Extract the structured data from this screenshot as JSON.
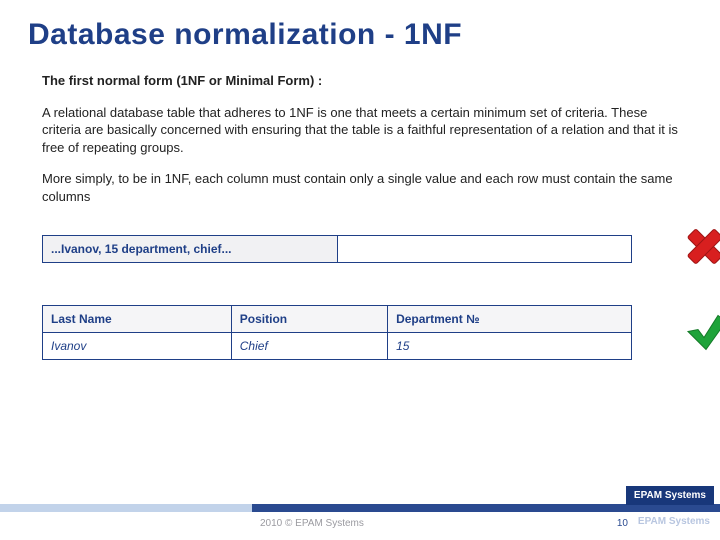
{
  "title": "Database normalization - 1NF",
  "intro_bold": "The first normal form (1NF or Minimal Form) :",
  "para1": "A relational database table that adheres to 1NF is one that meets a certain minimum set of criteria. These criteria are basically concerned with ensuring that the table is a faithful representation of a relation and that it is free of repeating groups.",
  "para2": "More simply, to be in 1NF, each column must contain only a single value and each row must contain the same columns",
  "bad_example": "...Ivanov, 15 department, chief...",
  "good_table": {
    "headers": [
      "Last Name",
      "Position",
      "Department №"
    ],
    "row": [
      "Ivanov",
      "Chief",
      "15"
    ]
  },
  "footer_copy": "2010 © EPAM Systems",
  "brand": "EPAM Systems",
  "page_number": "10"
}
